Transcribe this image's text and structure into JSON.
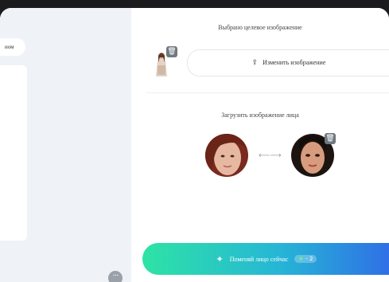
{
  "left_panel": {
    "pill_label": "иом",
    "more_icon": "more-dots-icon"
  },
  "target": {
    "title": "Выбрано целевое изображение",
    "change_label": "Изменить изображение",
    "upload_icon": "upload-icon",
    "trash_icon": "trash-icon"
  },
  "face": {
    "title": "Загрузить изображение лица",
    "swap_icon": "swap-arrows-icon",
    "trash_icon": "trash-icon"
  },
  "action": {
    "label": "Поменяй лицо сейчас",
    "wand_icon": "magic-wand-icon",
    "credit": "- 2",
    "credit_icon": "leaf-icon"
  },
  "colors": {
    "gradient_start": "#2ee3a5",
    "gradient_end": "#2f6fe6",
    "panel_bg": "#eff3f7"
  }
}
